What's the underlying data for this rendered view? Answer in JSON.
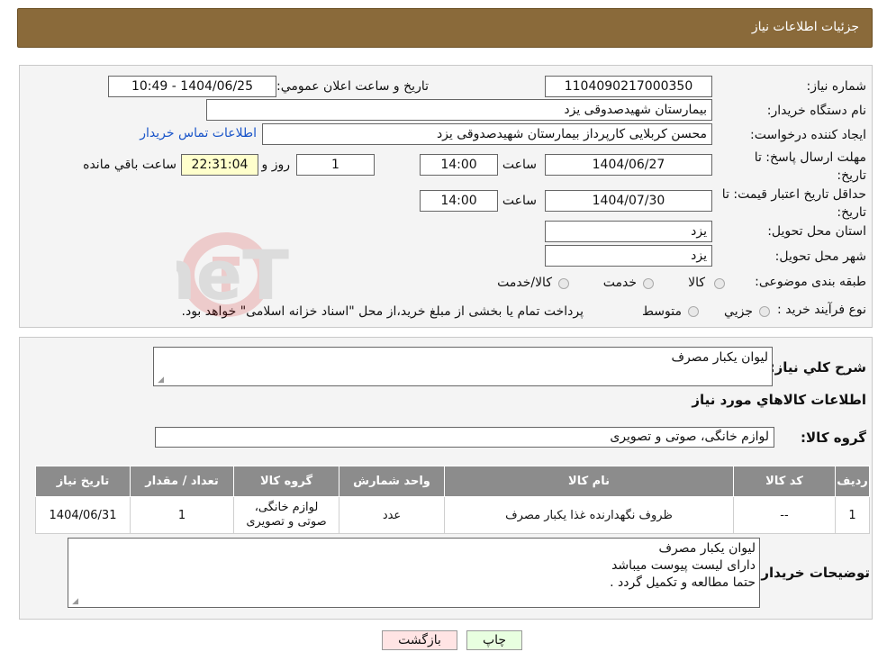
{
  "header": {
    "title": "جزئیات اطلاعات نیاز"
  },
  "form": {
    "need_number_label": "شماره نیاز:",
    "need_number": "1104090217000350",
    "announce_label": "تاریخ و ساعت اعلان عمومي:",
    "announce_value": "1404/06/25 - 10:49",
    "buyer_label": "نام دستگاه خريدار:",
    "buyer_value": "بیمارستان شهیدصدوقی یزد",
    "creator_label": "ایجاد کننده درخواست:",
    "creator_value": "محسن کربلایی کارپرداز بیمارستان شهیدصدوقی یزد",
    "contact_link": "اطلاعات تماس خريدار",
    "deadline_label": "مهلت ارسال پاسخ: تا تاریخ:",
    "deadline_date": "1404/06/27",
    "time_label": "ساعت",
    "deadline_time": "14:00",
    "days_value": "1",
    "days_label": "روز و",
    "remaining_value": "22:31:04",
    "remaining_label": "ساعت باقي مانده",
    "validity_label": "حداقل تاريخ اعتبار قيمت: تا تاریخ:",
    "validity_date": "1404/07/30",
    "validity_time": "14:00",
    "province_label": "استان محل تحويل:",
    "province_value": "یزد",
    "city_label": "شهر محل تحويل:",
    "city_value": "یزد",
    "category_label": "طبقه بندی موضوعی:",
    "category_options": [
      "کالا",
      "خدمت",
      "کالا/خدمت"
    ],
    "process_label": "نوع فرآيند خريد :",
    "process_options": [
      "جزيي",
      "متوسط"
    ],
    "process_note": "پرداخت تمام يا بخشی از مبلغ خريد،از محل \"اسناد خزانه اسلامی\" خواهد بود."
  },
  "details": {
    "summary_label": "شرح كلي نياز:",
    "summary_value": "لیوان یکبار مصرف",
    "goods_info_title": "اطلاعات كالاهاي مورد نياز",
    "group_label": "گروه كالا:",
    "group_value": "لوازم خانگی، صوتی و تصویری"
  },
  "table": {
    "headers": [
      "رديف",
      "كد كالا",
      "نام كالا",
      "واحد شمارش",
      "گروه كالا",
      "تعداد / مقدار",
      "تاريخ نياز"
    ],
    "rows": [
      [
        "1",
        "--",
        "ظروف نگهدارنده غذا یکبار مصرف",
        "عدد",
        "لوازم خانگی، صوتی و تصویری",
        "1",
        "1404/06/31"
      ]
    ]
  },
  "buyer_notes": {
    "label": "توضيحات خريدار:",
    "lines": [
      "لیوان یکبار مصرف",
      "دارای لیست پیوست میباشد",
      "حتما مطالعه و تکمیل گردد ."
    ]
  },
  "buttons": {
    "print": "چاپ",
    "back": "بازگشت"
  },
  "watermark": {
    "text": "AriaTender.neT"
  },
  "colors": {
    "header_bg": "#8a6a3a",
    "table_header_bg": "#8c8c8c",
    "link": "#1a55c9",
    "timer_bg": "#ffffcc",
    "back_btn_bg": "#ffe4e4",
    "print_btn_bg": "#e8ffe0"
  }
}
